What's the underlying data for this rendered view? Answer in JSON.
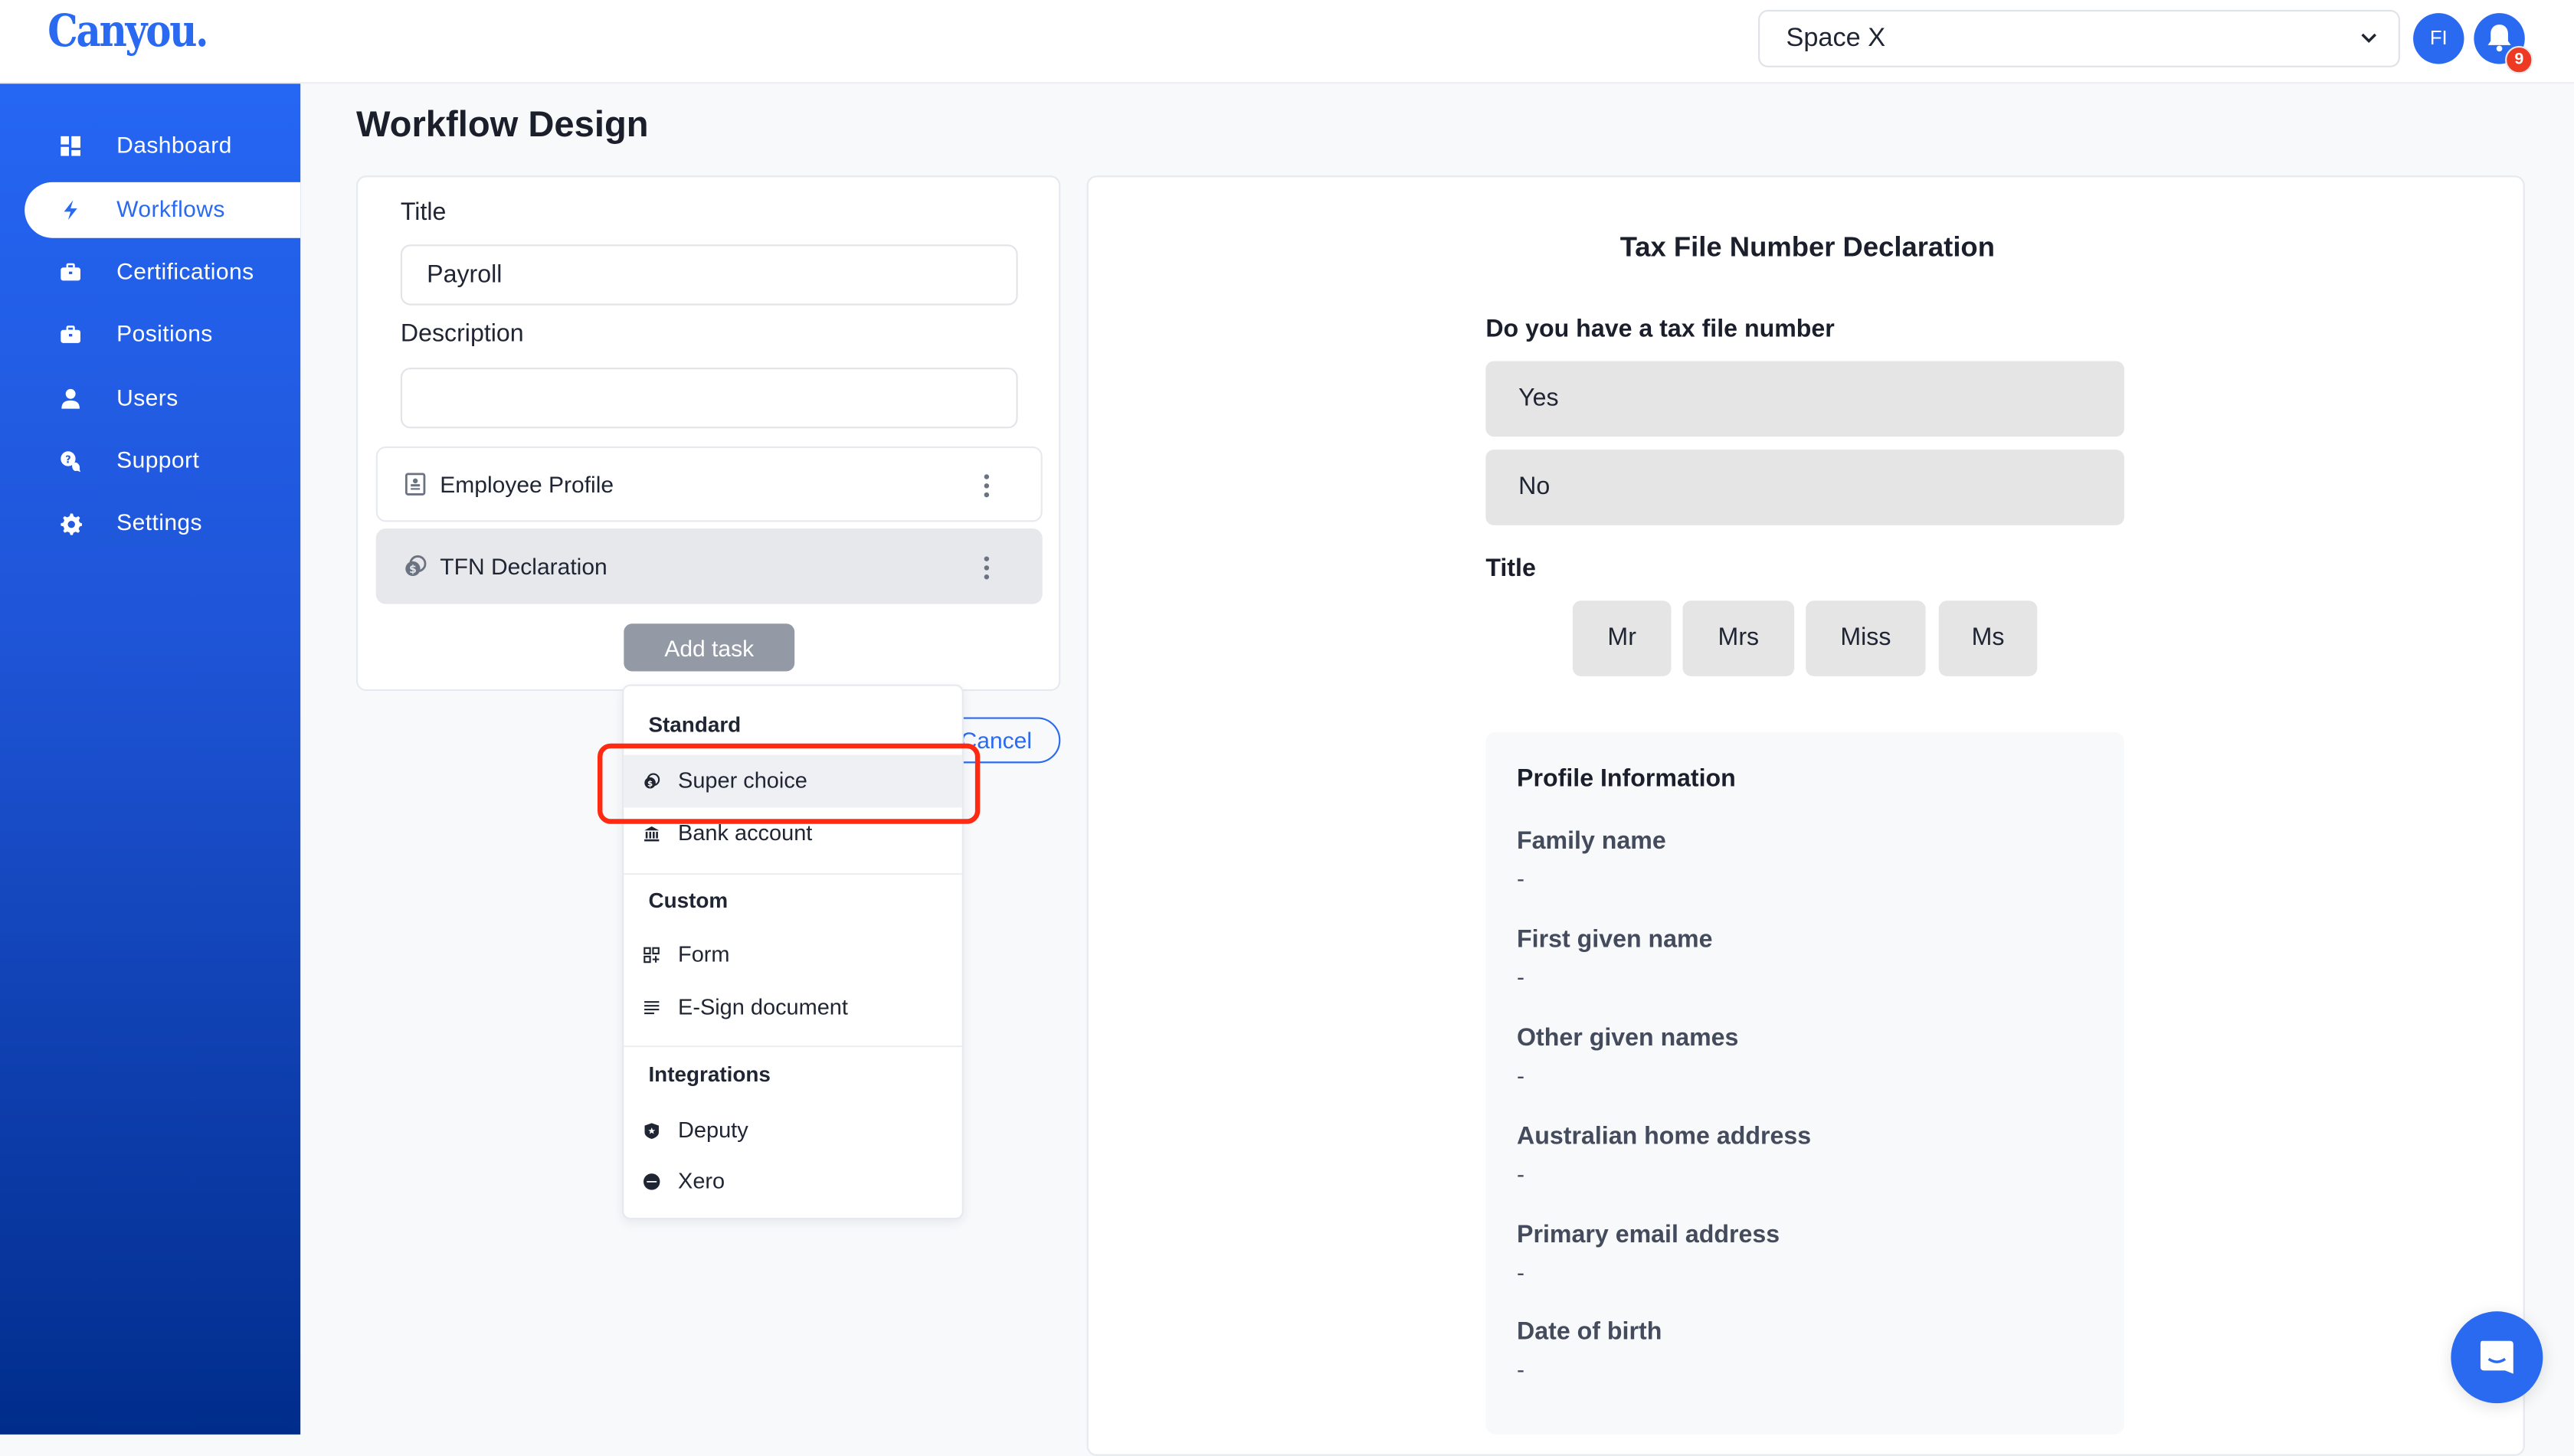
{
  "app": {
    "logo": "Canyou.",
    "space_selector": {
      "value": "Space X"
    },
    "user_initials": "FI",
    "notifications_count": "9",
    "brand_color": "#2a6af0",
    "highlight_color": "#ff2a12"
  },
  "sidebar": {
    "items": [
      {
        "label": "Dashboard",
        "icon": "dashboard-icon",
        "active": false
      },
      {
        "label": "Workflows",
        "icon": "lightning-icon",
        "active": true
      },
      {
        "label": "Certifications",
        "icon": "briefcase-icon",
        "active": false
      },
      {
        "label": "Positions",
        "icon": "briefcase-icon",
        "active": false
      },
      {
        "label": "Users",
        "icon": "user-icon",
        "active": false
      },
      {
        "label": "Support",
        "icon": "support-chat-icon",
        "active": false
      },
      {
        "label": "Settings",
        "icon": "gear-icon",
        "active": false
      }
    ]
  },
  "page": {
    "title": "Workflow Design"
  },
  "editor": {
    "title_label": "Title",
    "title_value": "Payroll",
    "description_label": "Description",
    "description_value": "",
    "tasks": [
      {
        "label": "Employee Profile",
        "icon": "id-card-icon",
        "selected": false
      },
      {
        "label": "TFN Declaration",
        "icon": "coins-icon",
        "selected": true
      }
    ],
    "add_task_label": "Add task",
    "cancel_label": "Cancel"
  },
  "add_task_menu": {
    "sections": [
      {
        "heading": "Standard",
        "items": [
          {
            "label": "Super choice",
            "icon": "coins-icon",
            "hovered": true
          },
          {
            "label": "Bank account",
            "icon": "bank-icon"
          }
        ]
      },
      {
        "heading": "Custom",
        "items": [
          {
            "label": "Form",
            "icon": "form-add-icon"
          },
          {
            "label": "E-Sign document",
            "icon": "document-lines-icon"
          }
        ]
      },
      {
        "heading": "Integrations",
        "items": [
          {
            "label": "Deputy",
            "icon": "deputy-shield-icon"
          },
          {
            "label": "Xero",
            "icon": "xero-logo-icon"
          }
        ]
      }
    ]
  },
  "preview": {
    "form_title": "Tax File Number Declaration",
    "tfn_question": "Do you have a tax file number",
    "tfn_options": [
      "Yes",
      "No"
    ],
    "title_question": "Title",
    "title_options": [
      "Mr",
      "Mrs",
      "Miss",
      "Ms"
    ],
    "profile": {
      "heading": "Profile Information",
      "fields": [
        {
          "label": "Family name",
          "value": "-"
        },
        {
          "label": "First given name",
          "value": "-"
        },
        {
          "label": "Other given names",
          "value": "-"
        },
        {
          "label": "Australian home address",
          "value": "-"
        },
        {
          "label": "Primary email address",
          "value": "-"
        },
        {
          "label": "Date of birth",
          "value": "-"
        }
      ]
    }
  }
}
